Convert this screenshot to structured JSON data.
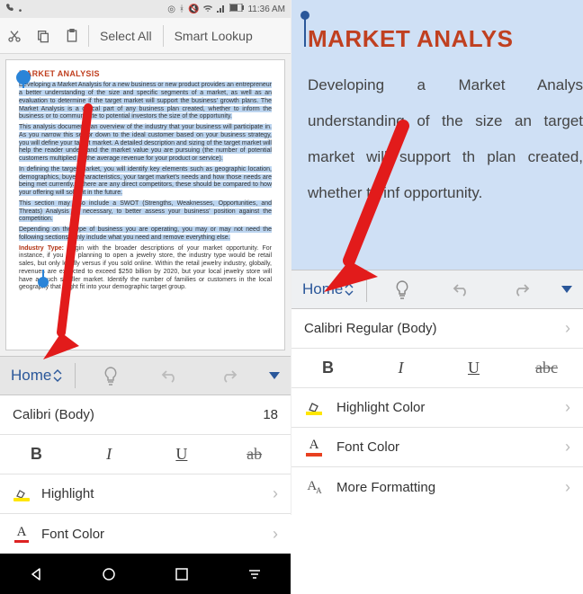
{
  "status": {
    "time": "11:36 AM"
  },
  "topbar": {
    "select_all": "Select All",
    "smart_lookup": "Smart Lookup"
  },
  "doc": {
    "title": "MARKET ANALYSIS",
    "p1": "Developing a Market Analysis for a new business or new product provides an entrepreneur a better understanding of the size and specific segments of a market, as well as an evaluation to determine if the target market will support the business' growth plans. The Market Analysis is a critical part of any business plan created, whether to inform the business or to communicate to potential investors the size of the opportunity.",
    "p2": "This analysis documents an overview of the industry that your business will participate in. As you narrow this sector down to the ideal customer based on your business strategy, you will define your target market. A detailed description and sizing of the target market will help the reader understand the market value you are pursuing (the number of potential customers multiplied by the average revenue for your product or service).",
    "p3": "In defining the target market, you will identify key elements such as geographic location, demographics, buyer characteristics, your target market's needs and how those needs are being met currently. If there are any direct competitors, these should be compared to how your offering will solve it in the future.",
    "p4a": "This section may also include a SWOT (Strengths, Weaknesses, Opportunities, and Threats) Analysis as necessary, to better assess your business' position against the competition.",
    "p4b": "Depending on the type of business you are operating, you may or may not need the following sections. Only include what you need and remove everything else.",
    "p5_label": "Industry Type:",
    "p5": "Begin with the broader descriptions of your market opportunity. For instance, if you are planning to open a jewelry store, the industry type would be retail sales, but only locally versus if you sold online. Within the retail jewelry industry, globally, revenues are expected to exceed $250 billion by 2020, but your local jewelry store will have a much smaller market. Identify the number of families or customers in the local geography that might fit into your demographic target group."
  },
  "ribbon": {
    "home": "Home"
  },
  "formatting": {
    "font_label_a": "Calibri (Body)",
    "font_size_a": "18",
    "font_label_b": "Calibri Regular (Body)",
    "bold": "B",
    "italic": "I",
    "underline": "U",
    "strike_a": "ab",
    "strike_b": "abc",
    "highlight_a": "Highlight",
    "highlight_b": "Highlight Color",
    "font_color": "Font Color",
    "more_formatting": "More Formatting"
  },
  "zoom": {
    "title": "MARKET ANALYS",
    "body": "Developing a Market Analys understanding of the size an target market will support th plan created, whether to inf opportunity."
  }
}
